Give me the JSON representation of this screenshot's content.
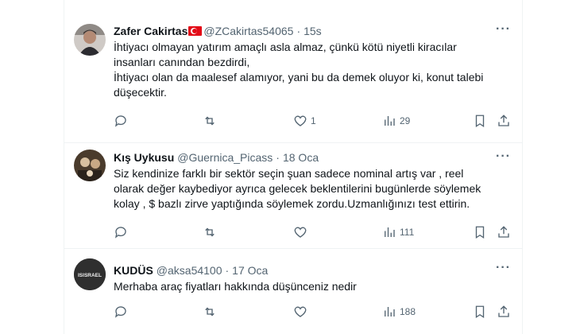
{
  "tweets": [
    {
      "name": "Zafer Cakirtas",
      "handle": "@ZCakirtas54065",
      "time": "15s",
      "text": "İhtiyacı olmayan yatırım amaçlı asla almaz, çünkü kötü niyetli kiracılar\ninsanları canından bezdirdi,\nİhtiyacı olan da maalesef alamıyor, yani bu da demek oluyor ki, konut talebi\ndüşecektir.",
      "replies": "",
      "retweets": "",
      "likes": "1",
      "views": "29"
    },
    {
      "name": "Kış Uykusu",
      "handle": "@Guernica_Picass",
      "time": "18 Oca",
      "text": "Siz kendinize farklı bir sektör seçin şuan sadece nominal artış var , reel\nolarak değer kaybediyor ayrıca gelecek beklentilerini bugünlerde söylemek\nkolay , $ bazlı zirve yaptığında söylemek zordu.Uzmanlığınızı test ettirin.",
      "replies": "",
      "retweets": "",
      "likes": "",
      "views": "111"
    },
    {
      "name": "KUDÜS",
      "handle": "@aksa54100",
      "time": "17 Oca",
      "text": "Merhaba araç fiyatları hakkında düşünceniz nedir",
      "avatar_text": "ISISRAEL",
      "replies": "",
      "retweets": "",
      "likes": "",
      "views": "188"
    }
  ],
  "colors": {
    "text": "#0f1419",
    "secondary": "#536471",
    "border": "#eff3f4",
    "flag": "#e30a17"
  }
}
